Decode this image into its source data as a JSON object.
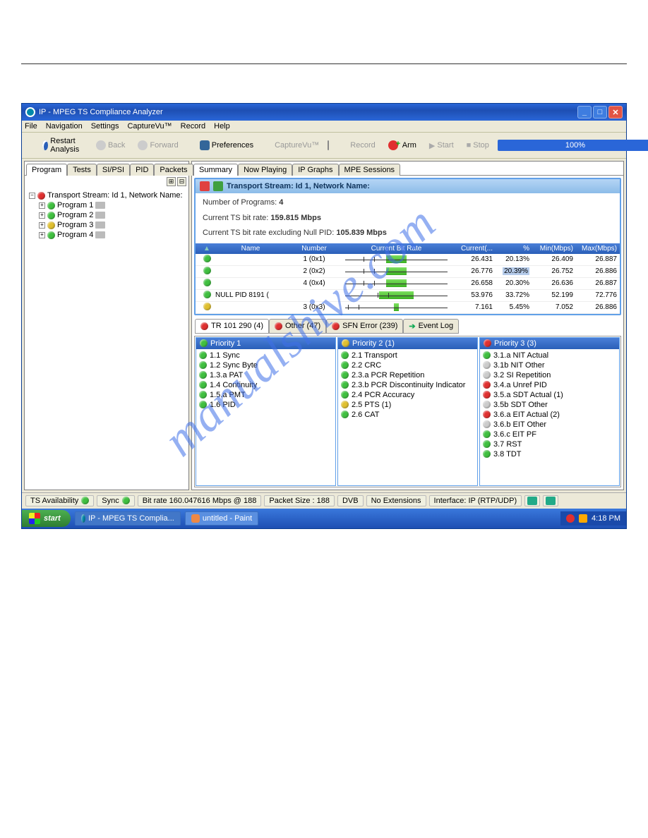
{
  "window": {
    "title": "IP - MPEG TS Compliance Analyzer"
  },
  "menu": [
    "File",
    "Navigation",
    "Settings",
    "CaptureVu™",
    "Record",
    "Help"
  ],
  "toolbar": {
    "restart": "Restart Analysis",
    "back": "Back",
    "forward": "Forward",
    "preferences": "Preferences",
    "capturevu": "CaptureVu™",
    "record": "Record",
    "arm": "Arm",
    "start": "Start",
    "stop": "Stop",
    "progress": "100%"
  },
  "left_tabs": [
    "Program",
    "Tests",
    "SI/PSI",
    "PID",
    "Packets"
  ],
  "tree": {
    "root": "Transport Stream: Id 1, Network Name:",
    "items": [
      {
        "label": "Program 1",
        "color": "green"
      },
      {
        "label": "Program 2",
        "color": "green"
      },
      {
        "label": "Program 3",
        "color": "yellow"
      },
      {
        "label": "Program 4",
        "color": "green"
      }
    ]
  },
  "right_tabs": [
    "Summary",
    "Now Playing",
    "IP Graphs",
    "MPE Sessions"
  ],
  "ts_header": "Transport Stream: Id 1, Network Name:",
  "ts_info": {
    "line1_label": "Number of Programs:",
    "line1_val": "4",
    "line2_label": "Current TS bit rate:",
    "line2_val": "159.815 Mbps",
    "line3_label": "Current TS bit rate excluding Null PID:",
    "line3_val": "105.839 Mbps"
  },
  "chart_data": {
    "type": "table",
    "columns": [
      "",
      "Name",
      "Number",
      "Current Bit Rate",
      "Current(...",
      "%",
      "Min(Mbps)",
      "Max(Mbps)"
    ],
    "rows": [
      {
        "status": "green",
        "name": "",
        "number": "1 (0x1)",
        "bar_pct": 20,
        "current": "26.431",
        "pct": "20.13%",
        "min": "26.409",
        "max": "26.887"
      },
      {
        "status": "green",
        "name": "",
        "number": "2 (0x2)",
        "bar_pct": 20,
        "current": "26.776",
        "pct": "20.39%",
        "min": "26.752",
        "max": "26.886",
        "pct_sel": true
      },
      {
        "status": "green",
        "name": "",
        "number": "4 (0x4)",
        "bar_pct": 20,
        "current": "26.658",
        "pct": "20.30%",
        "min": "26.636",
        "max": "26.887"
      },
      {
        "status": "green",
        "name": "NULL PID 8191 (",
        "number": "",
        "bar_pct": 34,
        "current": "53.976",
        "pct": "33.72%",
        "min": "52.199",
        "max": "72.776"
      },
      {
        "status": "yellow",
        "name": "",
        "number": "3 (0x3)",
        "bar_pct": 5,
        "current": "7.161",
        "pct": "5.45%",
        "min": "7.052",
        "max": "26.886"
      }
    ]
  },
  "error_tabs": [
    {
      "label": "TR 101 290 (4)",
      "color": "red",
      "active": true
    },
    {
      "label": "Other (47)",
      "color": "red"
    },
    {
      "label": "SFN Error (239)",
      "color": "red"
    },
    {
      "label": "Event Log",
      "arrow": true
    }
  ],
  "priorities": [
    {
      "header": "Priority 1",
      "color": "green",
      "items": [
        {
          "c": "green",
          "t": "1.1 Sync"
        },
        {
          "c": "green",
          "t": "1.2 Sync Byte"
        },
        {
          "c": "green",
          "t": "1.3.a PAT"
        },
        {
          "c": "green",
          "t": "1.4 Continuity"
        },
        {
          "c": "green",
          "t": "1.5.a PMT"
        },
        {
          "c": "green",
          "t": "1.6 PID"
        }
      ]
    },
    {
      "header": "Priority 2 (1)",
      "color": "yellow",
      "items": [
        {
          "c": "green",
          "t": "2.1 Transport"
        },
        {
          "c": "green",
          "t": "2.2 CRC"
        },
        {
          "c": "green",
          "t": "2.3.a PCR Repetition"
        },
        {
          "c": "green",
          "t": "2.3.b PCR Discontinuity Indicator"
        },
        {
          "c": "green",
          "t": "2.4 PCR Accuracy"
        },
        {
          "c": "yellow",
          "t": "2.5 PTS (1)"
        },
        {
          "c": "green",
          "t": "2.6 CAT"
        }
      ]
    },
    {
      "header": "Priority 3 (3)",
      "color": "red",
      "items": [
        {
          "c": "green",
          "t": "3.1.a NIT Actual"
        },
        {
          "c": "gray",
          "t": "3.1b NIT Other"
        },
        {
          "c": "gray",
          "t": "3.2 SI Repetition"
        },
        {
          "c": "red",
          "t": "3.4.a Unref PID"
        },
        {
          "c": "red",
          "t": "3.5.a SDT Actual (1)"
        },
        {
          "c": "gray",
          "t": "3.5b SDT Other"
        },
        {
          "c": "red",
          "t": "3.6.a EIT Actual (2)"
        },
        {
          "c": "gray",
          "t": "3.6.b EIT Other"
        },
        {
          "c": "green",
          "t": "3.6.c EIT PF"
        },
        {
          "c": "green",
          "t": "3.7 RST"
        },
        {
          "c": "green",
          "t": "3.8 TDT"
        }
      ]
    }
  ],
  "statusbar": {
    "ts_avail": "TS Availability",
    "sync": "Sync",
    "bitrate": "Bit rate 160.047616 Mbps @ 188",
    "packet": "Packet Size : 188",
    "dvb": "DVB",
    "noext": "No Extensions",
    "iface": "Interface: IP (RTP/UDP)"
  },
  "taskbar": {
    "start": "start",
    "task1": "IP - MPEG TS Complia...",
    "task2": "untitled - Paint",
    "time": "4:18 PM"
  },
  "watermark": "manualshive.com"
}
